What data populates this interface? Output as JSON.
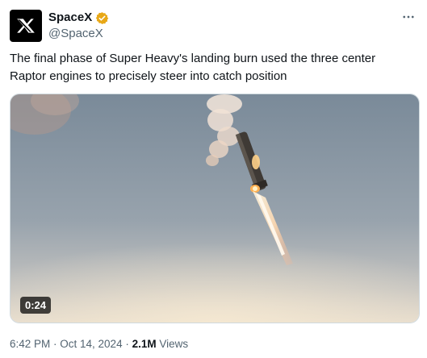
{
  "author": {
    "display_name": "SpaceX",
    "handle": "@SpaceX",
    "avatar_icon": "x-logo-icon",
    "verified_icon": "verified-badge-icon",
    "verified_color": "#e8a817"
  },
  "more_icon": "more-horizontal-icon",
  "tweet": {
    "text": "The final phase of Super Heavy's landing burn used the three center Raptor engines to precisely steer into catch position"
  },
  "media": {
    "type": "video",
    "duration": "0:24"
  },
  "meta": {
    "timestamp": "6:42 PM · Oct 14, 2024",
    "separator": " · ",
    "views_count": "2.1M",
    "views_label": " Views"
  },
  "colors": {
    "text_primary": "#0f1419",
    "text_secondary": "#536471",
    "border": "#cfd9de"
  }
}
